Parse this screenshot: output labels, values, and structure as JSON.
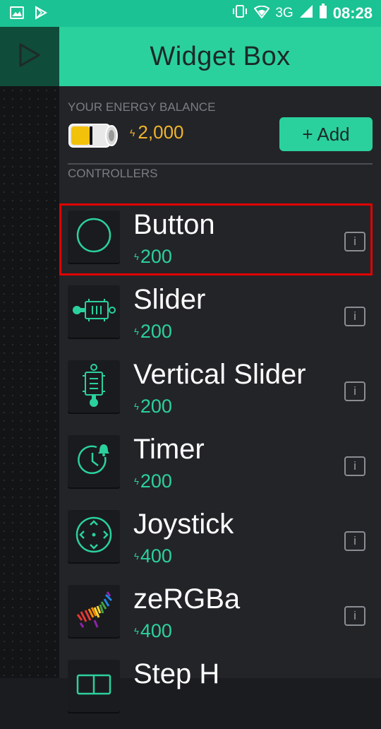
{
  "status_bar": {
    "network": "3G",
    "time": "08:28"
  },
  "header": {
    "title": "Widget Box"
  },
  "energy": {
    "label": "YOUR ENERGY BALANCE",
    "value": "2,000",
    "add_label": "+ Add"
  },
  "section": {
    "label": "CONTROLLERS"
  },
  "widgets": [
    {
      "name": "Button",
      "price": "200",
      "icon": "circle-button-icon"
    },
    {
      "name": "Slider",
      "price": "200",
      "icon": "slider-icon"
    },
    {
      "name": "Vertical Slider",
      "price": "200",
      "icon": "vertical-slider-icon"
    },
    {
      "name": "Timer",
      "price": "200",
      "icon": "timer-icon"
    },
    {
      "name": "Joystick",
      "price": "400",
      "icon": "joystick-icon"
    },
    {
      "name": "zeRGBa",
      "price": "400",
      "icon": "zebra-icon"
    },
    {
      "name": "Step H",
      "price": "",
      "icon": "step-h-icon"
    }
  ],
  "info_label": "i",
  "colors": {
    "accent": "#2bd19d",
    "status_bar": "#1bc294",
    "energy": "#f0b429",
    "highlight": "#e00000"
  }
}
